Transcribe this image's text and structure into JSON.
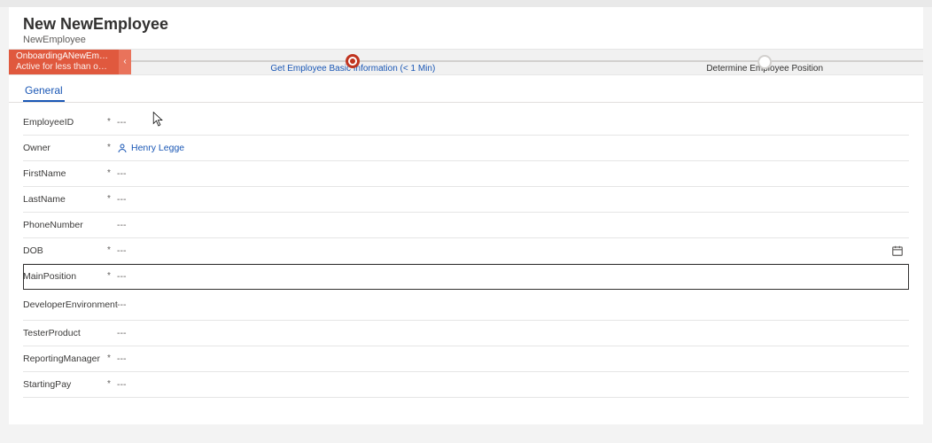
{
  "header": {
    "title": "New NewEmployee",
    "subtitle": "NewEmployee"
  },
  "bpf": {
    "flag_line1": "OnboardingANewEmplo...",
    "flag_line2": "Active for less than one mi...",
    "stage1_label": "Get Employee Basic Information",
    "stage1_time": "(< 1 Min)",
    "stage2_label": "Determine Employee Position"
  },
  "tabs": {
    "general": "General"
  },
  "form": {
    "employeeId": {
      "label": "EmployeeID",
      "required": "*",
      "value": "---"
    },
    "owner": {
      "label": "Owner",
      "required": "*",
      "value": "Henry Legge"
    },
    "firstName": {
      "label": "FirstName",
      "required": "*",
      "value": "---"
    },
    "lastName": {
      "label": "LastName",
      "required": "*",
      "value": "---"
    },
    "phoneNumber": {
      "label": "PhoneNumber",
      "required": "",
      "value": "---"
    },
    "dob": {
      "label": "DOB",
      "required": "*",
      "value": "---"
    },
    "mainPosition": {
      "label": "MainPosition",
      "required": "*",
      "value": "---"
    },
    "devEnv": {
      "label": "DeveloperEnvironment",
      "required": "",
      "value": "---"
    },
    "testerProduct": {
      "label": "TesterProduct",
      "required": "",
      "value": "---"
    },
    "reportingMgr": {
      "label": "ReportingManager",
      "required": "*",
      "value": "---"
    },
    "startingPay": {
      "label": "StartingPay",
      "required": "*",
      "value": "---"
    }
  }
}
